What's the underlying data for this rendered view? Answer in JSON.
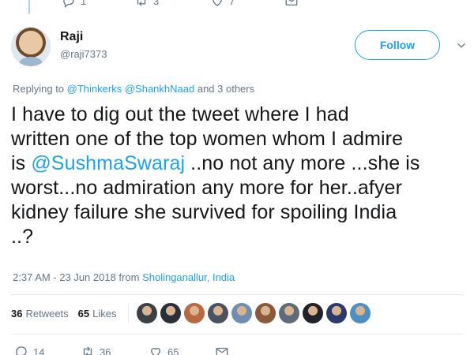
{
  "prev_tweet": {
    "reply_count": "1",
    "retweet_count": "3",
    "like_count": "7"
  },
  "user": {
    "name": "Raji",
    "handle": "@raji7373",
    "follow_label": "Follow"
  },
  "reply": {
    "prefix": "Replying to",
    "to_1": "@Thinkerks",
    "to_2": "@ShankhNaad",
    "others": "and 3 others"
  },
  "tweet": {
    "line1": "I have to dig out the tweet where I had",
    "line2": "written one of the top women whom I admire",
    "line3_prefix": "is ",
    "line3_mention": "@SushmaSwaraj",
    "line3_suffix": " ..no not any more ...she is",
    "line4": "worst...no admiration any more for her..afyer",
    "line5": "kidney failure she survived for spoiling India",
    "line6": "..?"
  },
  "meta": {
    "timestamp": "2:37 AM - 23 Jun 2018 from",
    "location": "Sholinganallur, India"
  },
  "stats": {
    "retweets_count": "36",
    "retweets_label": "Retweets",
    "likes_count": "65",
    "likes_label": "Likes",
    "liker_colors": [
      "#3b3f46",
      "#2a2f3a",
      "#b86a3e",
      "#4a5261",
      "#6f8fb0",
      "#8a5a3a",
      "#5d6b7a",
      "#1f2229",
      "#2b3a6b",
      "#4d8fc2"
    ]
  },
  "actions": {
    "reply_count": "14",
    "retweet_count": "36",
    "like_count": "65"
  },
  "colors": {
    "accent": "#1da1f2",
    "muted": "#657786",
    "text": "#14171a"
  }
}
